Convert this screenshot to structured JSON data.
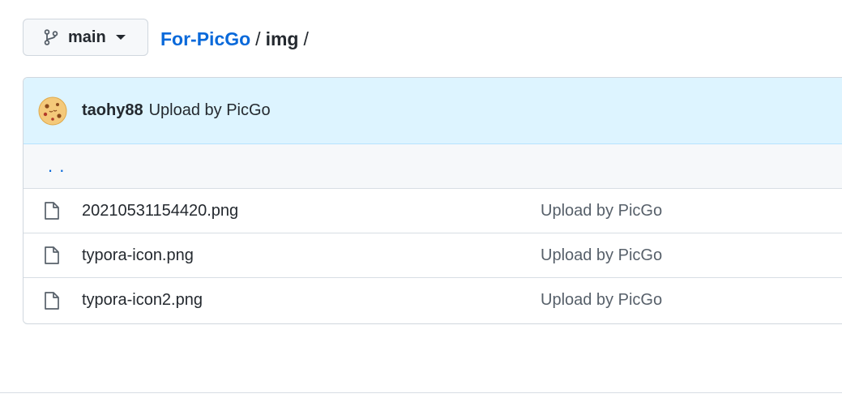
{
  "branch": {
    "name": "main",
    "icon": "git-branch-icon"
  },
  "breadcrumb": {
    "repo": "For-PicGo",
    "separator": "/",
    "folder": "img",
    "trailing": "/"
  },
  "commit": {
    "author": "taohy88",
    "message": "Upload by PicGo",
    "avatar_icon": "cookie-avatar-icon"
  },
  "parent_dir": {
    "label": ". ."
  },
  "files": [
    {
      "name": "20210531154420.png",
      "commit_message": "Upload by PicGo",
      "icon": "file-icon"
    },
    {
      "name": "typora-icon.png",
      "commit_message": "Upload by PicGo",
      "icon": "file-icon"
    },
    {
      "name": "typora-icon2.png",
      "commit_message": "Upload by PicGo",
      "icon": "file-icon"
    }
  ],
  "colors": {
    "link": "#0969da",
    "header_bg": "#ddf4ff",
    "text": "#24292f",
    "muted": "#57606a"
  }
}
